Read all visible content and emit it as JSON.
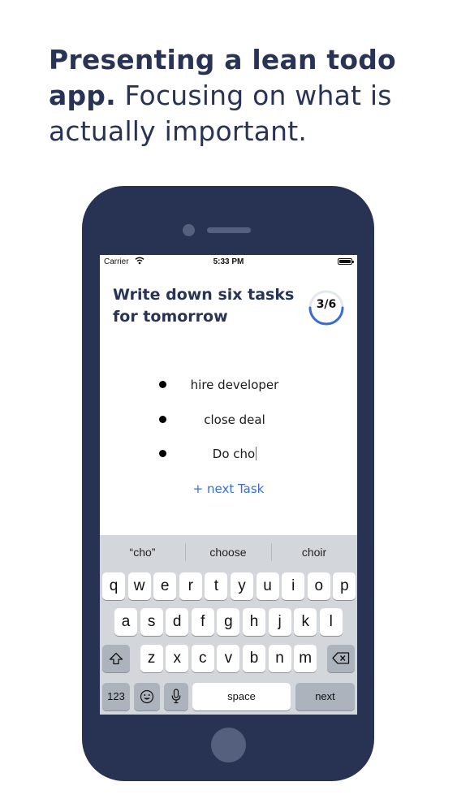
{
  "headline": {
    "bold": "Presenting a lean todo app.",
    "regular": " Focusing on what is actually important."
  },
  "status_bar": {
    "carrier": "Carrier",
    "time": "5:33 PM"
  },
  "screen": {
    "title": "Write down six tasks for tomorrow",
    "progress": {
      "label": "3/6",
      "completed": 3,
      "total": 6,
      "color": "#3b6cd6"
    },
    "tasks": [
      {
        "text": "hire developer"
      },
      {
        "text": "close deal"
      },
      {
        "text": "Do cho"
      }
    ],
    "next_task_label": "+ next Task"
  },
  "keyboard": {
    "suggestions": [
      "“cho”",
      "choose",
      "choir"
    ],
    "row1": [
      "q",
      "w",
      "e",
      "r",
      "t",
      "y",
      "u",
      "i",
      "o",
      "p"
    ],
    "row2": [
      "a",
      "s",
      "d",
      "f",
      "g",
      "h",
      "j",
      "k",
      "l"
    ],
    "row3": [
      "z",
      "x",
      "c",
      "v",
      "b",
      "n",
      "m"
    ],
    "numbers_label": "123",
    "space_label": "space",
    "next_label": "next"
  },
  "colors": {
    "navy": "#283252",
    "accent_blue": "#3b6cd6",
    "keyboard_bg": "#d3d6db"
  }
}
